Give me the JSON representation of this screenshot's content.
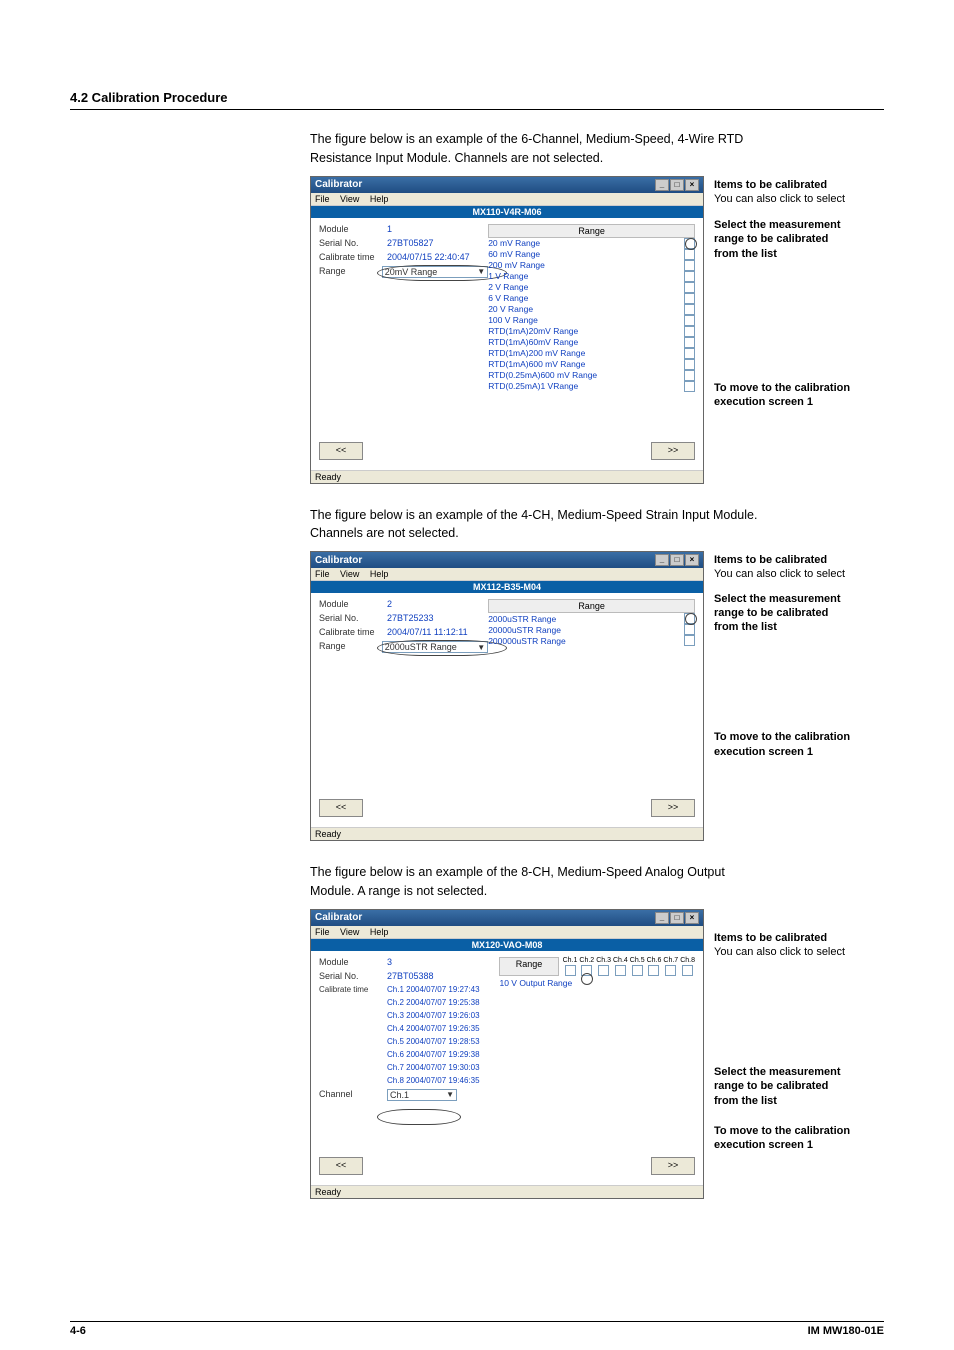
{
  "section_heading": "4.2  Calibration Procedure",
  "para1a": "The figure below is an example of the 6-Channel, Medium-Speed, 4-Wire RTD",
  "para1b": "Resistance Input Module. Channels are not selected.",
  "para2a": "The figure below is an example of the 4-CH, Medium-Speed Strain Input Module.",
  "para2b": "Channels are not selected.",
  "para3a": "The figure below is an example of the 8-CH, Medium-Speed Analog Output",
  "para3b": "Module. A range is not selected.",
  "window": {
    "title": "Calibrator",
    "menus": {
      "file": "File",
      "view": "View",
      "help": "Help"
    },
    "ready": "Ready",
    "prev": "<<",
    "next": ">>",
    "labels": {
      "module": "Module",
      "serial": "Serial No.",
      "caltime": "Calibrate time",
      "range": "Range",
      "channel": "Channel",
      "range_header": "Range"
    }
  },
  "fig1": {
    "module_header": "MX110-V4R-M06",
    "module": "1",
    "serial": "27BT05827",
    "caltime": "2004/07/15 22:40:47",
    "range": "20mV Range",
    "ranges": [
      "20 mV Range",
      "60 mV Range",
      "200 mV Range",
      "1 V Range",
      "2 V Range",
      "6 V Range",
      "20 V Range",
      "100 V Range",
      "RTD(1mA)20mV Range",
      "RTD(1mA)60mV Range",
      "RTD(1mA)200 mV Range",
      "RTD(1mA)600 mV Range",
      "RTD(0.25mA)600 mV Range",
      "RTD(0.25mA)1 VRange"
    ]
  },
  "fig2": {
    "module_header": "MX112-B35-M04",
    "module": "2",
    "serial": "27BT25233",
    "caltime": "2004/07/11 11:12:11",
    "range": "2000uSTR Range",
    "ranges": [
      "2000uSTR Range",
      "20000uSTR Range",
      "200000uSTR Range"
    ]
  },
  "fig3": {
    "module_header": "MX120-VAO-M08",
    "module": "3",
    "serial": "27BT05388",
    "range_row": "10 V Output Range",
    "channel_sel": "Ch.1",
    "channels": [
      "Ch.1",
      "Ch.2",
      "Ch.3",
      "Ch.4",
      "Ch.5",
      "Ch.6",
      "Ch.7",
      "Ch.8"
    ],
    "caltimes": [
      {
        "ch": "Ch.1",
        "ts": "2004/07/07 19:27:43"
      },
      {
        "ch": "Ch.2",
        "ts": "2004/07/07 19:25:38"
      },
      {
        "ch": "Ch.3",
        "ts": "2004/07/07 19:26:03"
      },
      {
        "ch": "Ch.4",
        "ts": "2004/07/07 19:26:35"
      },
      {
        "ch": "Ch.5",
        "ts": "2004/07/07 19:28:53"
      },
      {
        "ch": "Ch.6",
        "ts": "2004/07/07 19:29:38"
      },
      {
        "ch": "Ch.7",
        "ts": "2004/07/07 19:30:03"
      },
      {
        "ch": "Ch.8",
        "ts": "2004/07/07 19:46:35"
      }
    ]
  },
  "annotations": {
    "items_title": "Items to be calibrated",
    "items_text": "You can also click to select",
    "select_title": "Select the measurement",
    "select_text1": "range to be calibrated",
    "select_text2": "from the list",
    "move_title": "To move to the calibration",
    "move_text": "execution screen 1"
  },
  "footer": {
    "page": "4-6",
    "doc": "IM MW180-01E"
  }
}
